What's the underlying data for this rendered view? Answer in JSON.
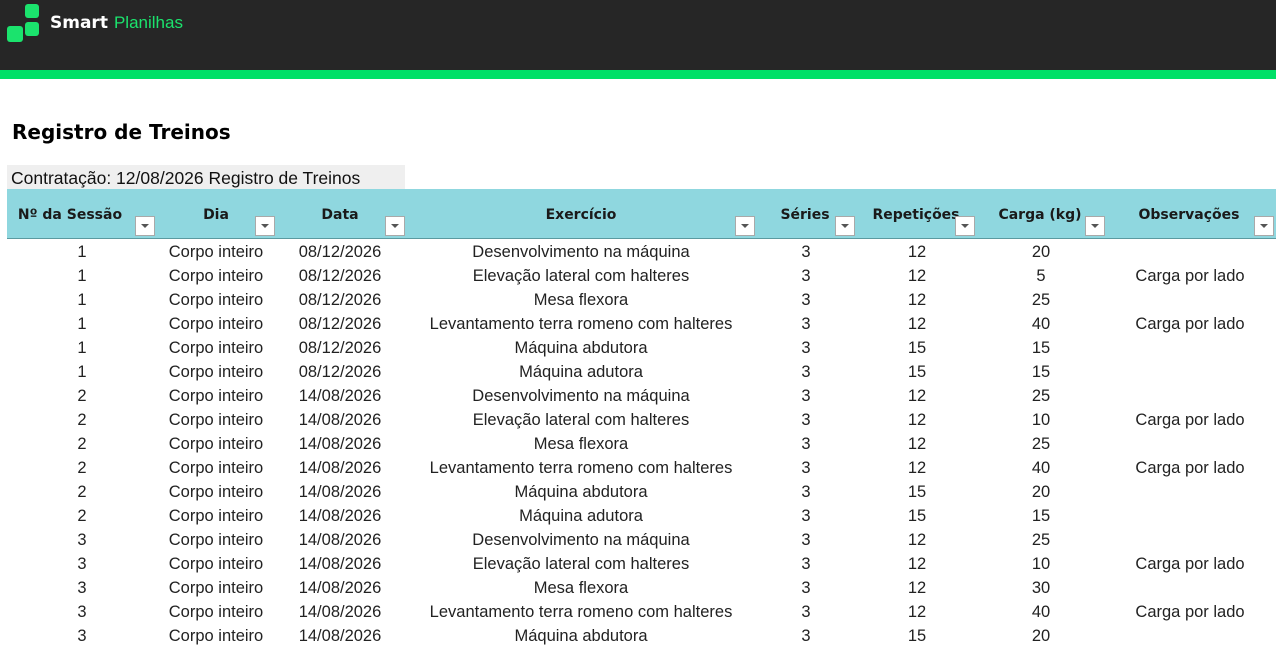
{
  "brand": {
    "name_bold": "Smart",
    "name_light": "Planilhas"
  },
  "colors": {
    "topbar": "#262626",
    "accent": "#00e067",
    "header_bg": "#8fd7df",
    "logo_green": "#1be36d"
  },
  "page": {
    "title": "Registro de Treinos",
    "subtitle": "Contratação: 12/08/2026 Registro de Treinos"
  },
  "table": {
    "columns": [
      "Nº da Sessão",
      "Dia",
      "Data",
      "Exercício",
      "Séries",
      "Repetições",
      "Carga (kg)",
      "Observações"
    ],
    "filter_icon": "chevron-down-icon",
    "rows": [
      [
        "1",
        "Corpo inteiro",
        "08/12/2026",
        "Desenvolvimento na máquina",
        "3",
        "12",
        "20",
        ""
      ],
      [
        "1",
        "Corpo inteiro",
        "08/12/2026",
        "Elevação lateral com halteres",
        "3",
        "12",
        "5",
        "Carga por lado"
      ],
      [
        "1",
        "Corpo inteiro",
        "08/12/2026",
        "Mesa flexora",
        "3",
        "12",
        "25",
        ""
      ],
      [
        "1",
        "Corpo inteiro",
        "08/12/2026",
        "Levantamento terra romeno com halteres",
        "3",
        "12",
        "40",
        "Carga por lado"
      ],
      [
        "1",
        "Corpo inteiro",
        "08/12/2026",
        "Máquina abdutora",
        "3",
        "15",
        "15",
        ""
      ],
      [
        "1",
        "Corpo inteiro",
        "08/12/2026",
        "Máquina adutora",
        "3",
        "15",
        "15",
        ""
      ],
      [
        "2",
        "Corpo inteiro",
        "14/08/2026",
        "Desenvolvimento na máquina",
        "3",
        "12",
        "25",
        ""
      ],
      [
        "2",
        "Corpo inteiro",
        "14/08/2026",
        "Elevação lateral com halteres",
        "3",
        "12",
        "10",
        "Carga por lado"
      ],
      [
        "2",
        "Corpo inteiro",
        "14/08/2026",
        "Mesa flexora",
        "3",
        "12",
        "25",
        ""
      ],
      [
        "2",
        "Corpo inteiro",
        "14/08/2026",
        "Levantamento terra romeno com halteres",
        "3",
        "12",
        "40",
        "Carga por lado"
      ],
      [
        "2",
        "Corpo inteiro",
        "14/08/2026",
        "Máquina abdutora",
        "3",
        "15",
        "20",
        ""
      ],
      [
        "2",
        "Corpo inteiro",
        "14/08/2026",
        "Máquina adutora",
        "3",
        "15",
        "15",
        ""
      ],
      [
        "3",
        "Corpo inteiro",
        "14/08/2026",
        "Desenvolvimento na máquina",
        "3",
        "12",
        "25",
        ""
      ],
      [
        "3",
        "Corpo inteiro",
        "14/08/2026",
        "Elevação lateral com halteres",
        "3",
        "12",
        "10",
        "Carga por lado"
      ],
      [
        "3",
        "Corpo inteiro",
        "14/08/2026",
        "Mesa flexora",
        "3",
        "12",
        "30",
        ""
      ],
      [
        "3",
        "Corpo inteiro",
        "14/08/2026",
        "Levantamento terra romeno com halteres",
        "3",
        "12",
        "40",
        "Carga por lado"
      ],
      [
        "3",
        "Corpo inteiro",
        "14/08/2026",
        "Máquina abdutora",
        "3",
        "15",
        "20",
        ""
      ]
    ]
  }
}
